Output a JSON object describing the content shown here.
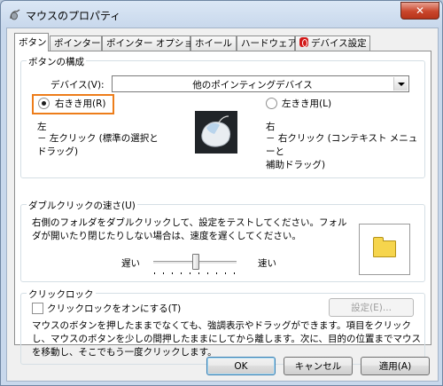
{
  "window": {
    "title": "マウスのプロパティ",
    "close_label": "✕"
  },
  "tabs": [
    {
      "label": "ボタン",
      "active": true
    },
    {
      "label": "ポインター"
    },
    {
      "label": "ポインター オプション"
    },
    {
      "label": "ホイール"
    },
    {
      "label": "ハードウェア"
    },
    {
      "label": "デバイス設定"
    }
  ],
  "button_config": {
    "group_title": "ボタンの構成",
    "device_label": "デバイス(V):",
    "device_value": "他のポインティングデバイス",
    "right_handed_label": "右きき用(R)",
    "left_handed_label": "左きき用(L)",
    "left_title": "左",
    "left_desc": "－ 左クリック (標準の選択と\nドラッグ)",
    "right_title": "右",
    "right_desc": "－ 右クリック (コンテキスト メニューと\n補助ドラッグ)"
  },
  "double_click": {
    "group_title": "ダブルクリックの速さ(U)",
    "description": "右側のフォルダをダブルクリックして、設定をテストしてください。フォルダが開いたり閉じたりしない場合は、速度を遅くしてください。",
    "slow_label": "遅い",
    "fast_label": "速い",
    "slider_value": 0.5
  },
  "click_lock": {
    "group_title": "クリックロック",
    "checkbox_label": "クリックロックをオンにする(T)",
    "checked": false,
    "settings_button": "設定(E)...",
    "description": "マウスのボタンを押したままでなくても、強調表示やドラッグができます。項目をクリックし、マウスのボタンを少しの間押したままにしてから離します。次に、目的の位置までマウスを移動し、そこでもう一度クリックします。"
  },
  "footer": {
    "ok": "OK",
    "cancel": "キャンセル",
    "apply": "適用(A)"
  },
  "colors": {
    "highlight": "#ed7d1a",
    "close_button": "#c9462c"
  }
}
